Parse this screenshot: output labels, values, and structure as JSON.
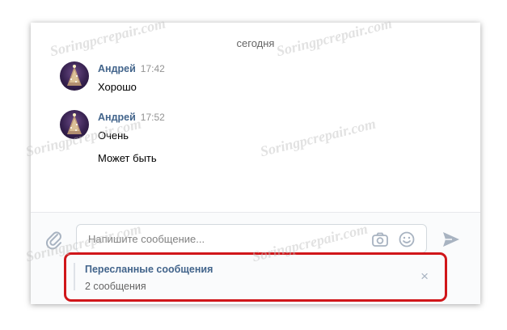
{
  "chat": {
    "date_separator": "сегодня",
    "messages": [
      {
        "author": "Андрей",
        "time": "17:42",
        "lines": [
          "Хорошо"
        ]
      },
      {
        "author": "Андрей",
        "time": "17:52",
        "lines": [
          "Очень",
          "Может быть"
        ]
      }
    ]
  },
  "composer": {
    "placeholder": "Напишите сообщение...",
    "icons": [
      "paperclip-icon",
      "camera-icon",
      "smile-icon",
      "send-arrow-icon"
    ]
  },
  "forwarded": {
    "title": "Пересланные сообщения",
    "count_label": "2 сообщения",
    "close_glyph": "×"
  },
  "watermark": {
    "text": "Soringpcrepair.com"
  },
  "colors": {
    "accent": "#42648b",
    "highlight": "#d0161a",
    "icon": "#a8b3c1"
  }
}
